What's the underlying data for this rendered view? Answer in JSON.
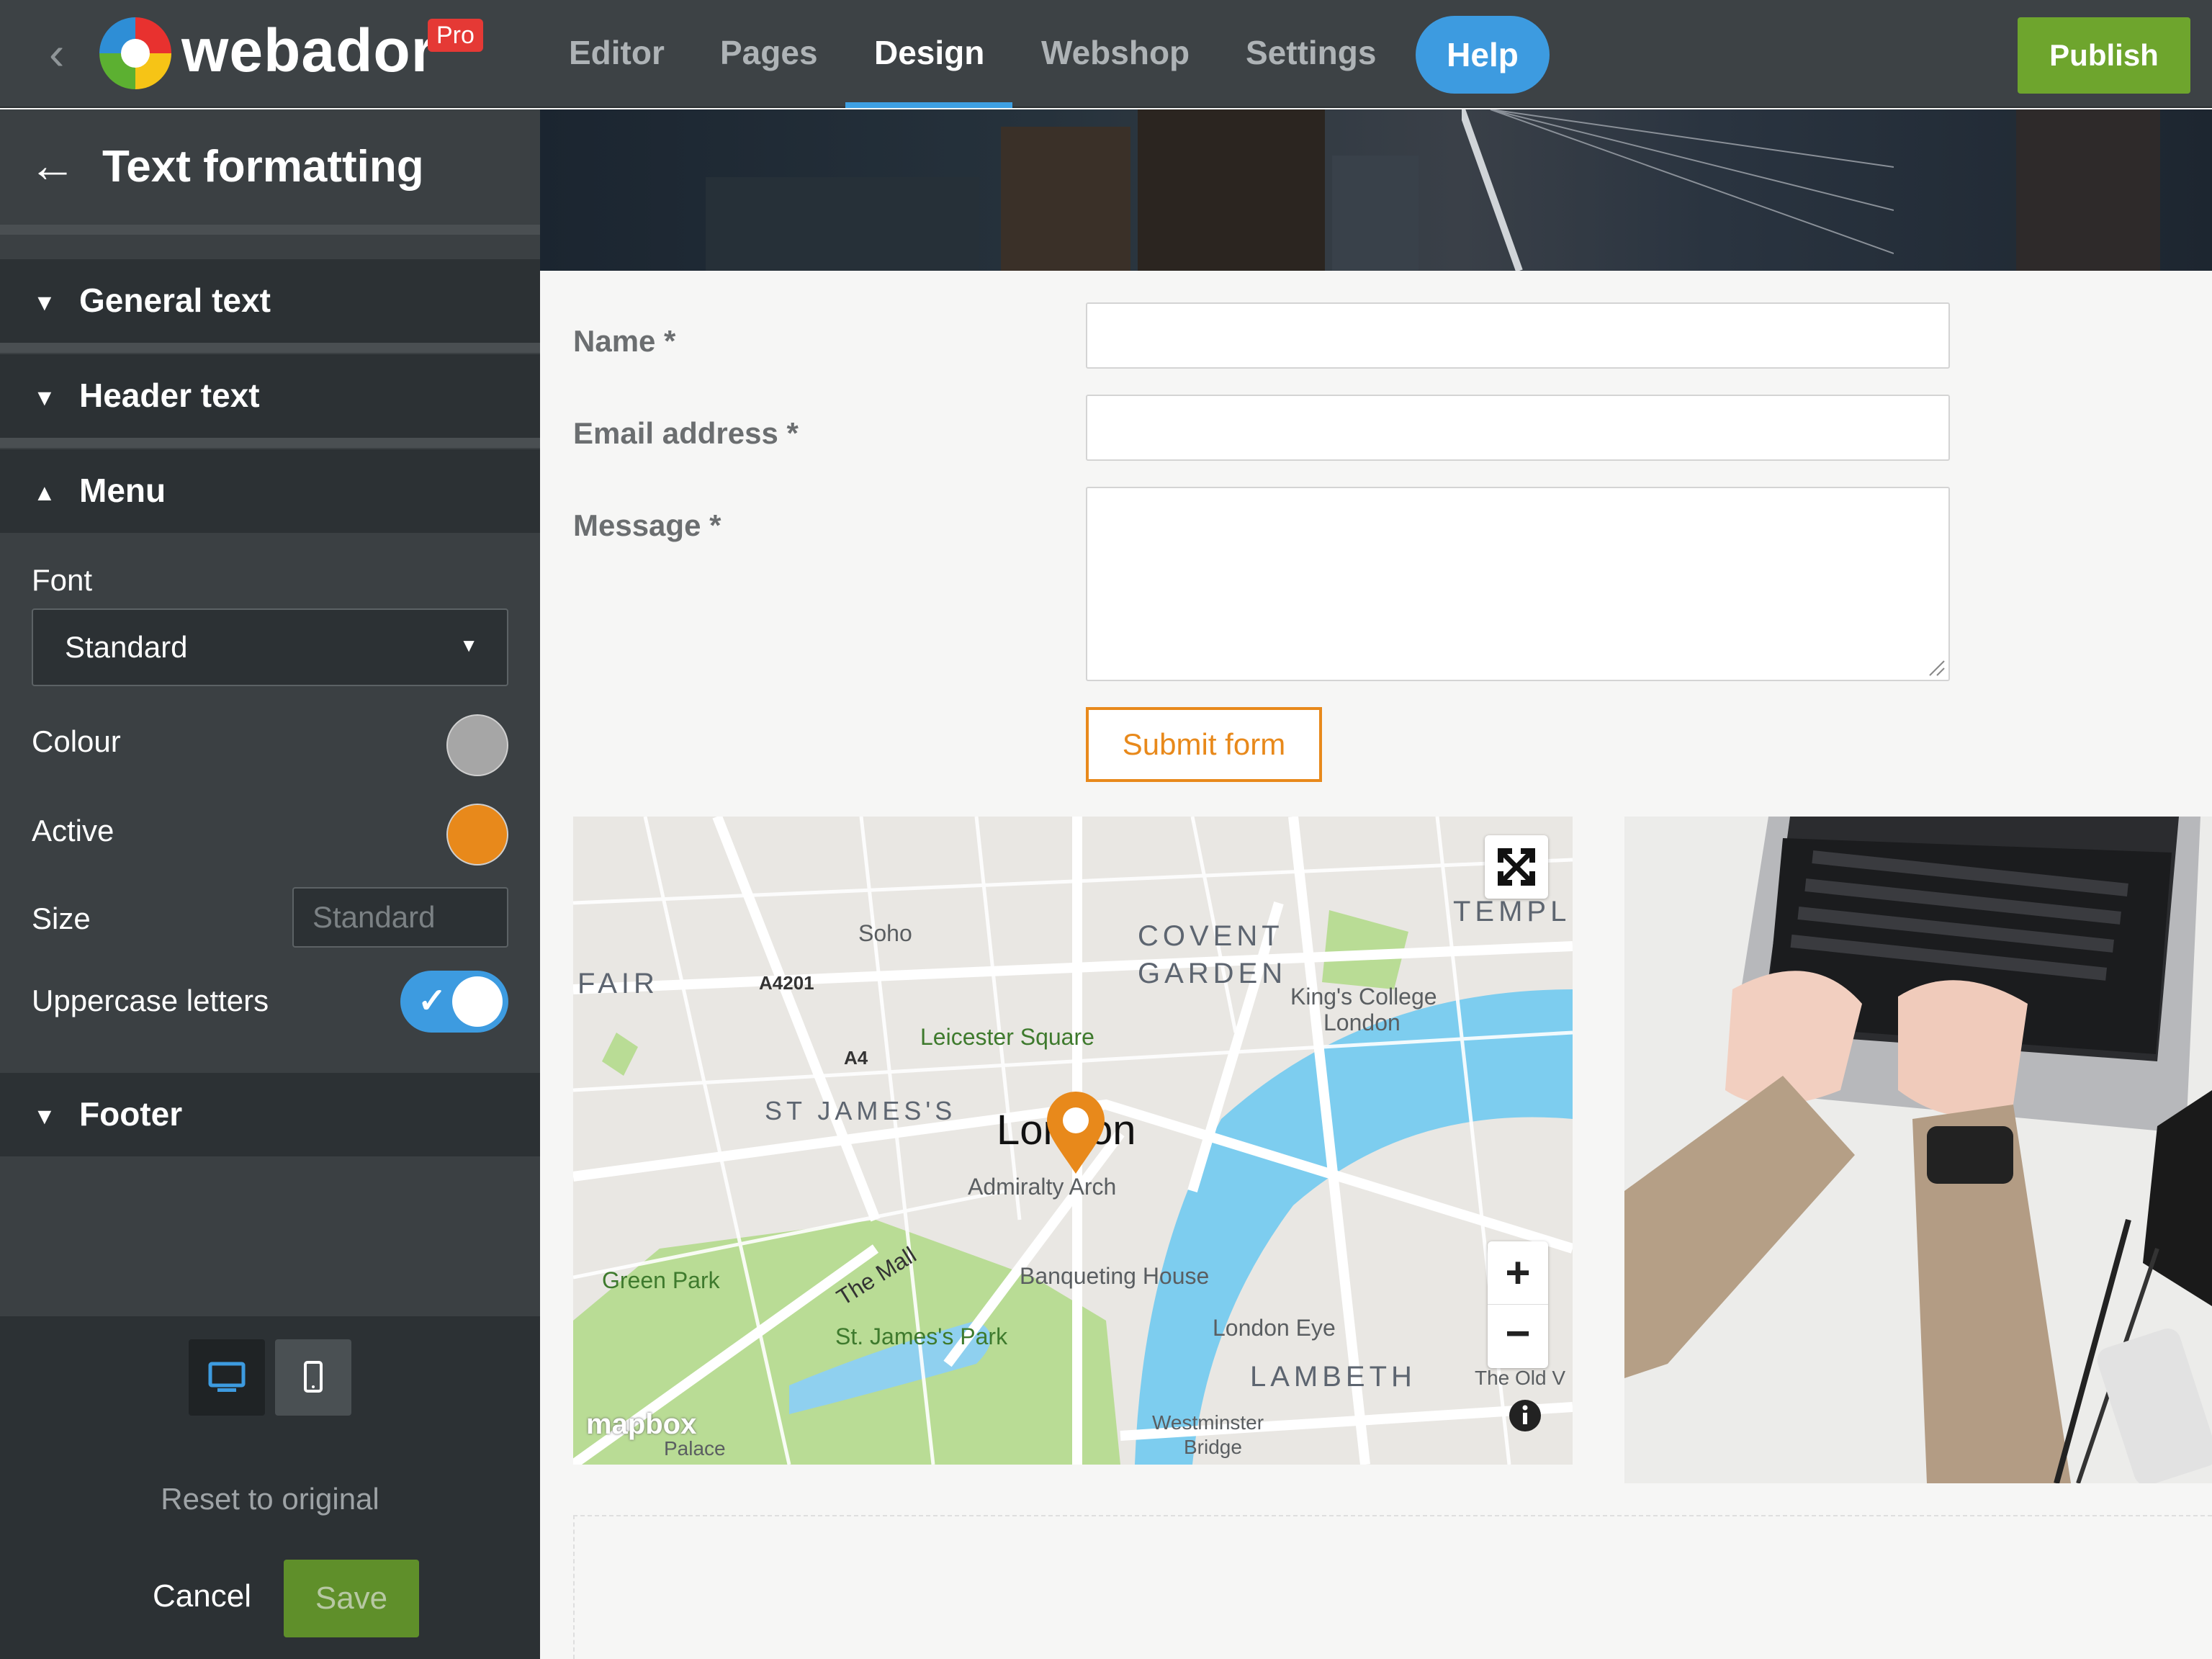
{
  "topbar": {
    "logo_text": "webador",
    "pro_badge": "Pro",
    "nav": [
      "Editor",
      "Pages",
      "Design",
      "Webshop",
      "Settings"
    ],
    "active_nav": "Design",
    "help_label": "Help",
    "publish_label": "Publish"
  },
  "sidebar": {
    "title": "Text formatting",
    "sections": {
      "general": "General text",
      "header": "Header text",
      "menu": "Menu",
      "footer": "Footer"
    },
    "menu": {
      "font_label": "Font",
      "font_value": "Standard",
      "colour_label": "Colour",
      "colour_value": "#a6a6a6",
      "active_label": "Active",
      "active_value": "#e8891b",
      "size_label": "Size",
      "size_placeholder": "Standard",
      "uppercase_label": "Uppercase letters",
      "uppercase_on": true
    },
    "reset_label": "Reset to original",
    "cancel_label": "Cancel",
    "save_label": "Save"
  },
  "form": {
    "name_label": "Name *",
    "email_label": "Email address *",
    "message_label": "Message *",
    "submit_label": "Submit form"
  },
  "map": {
    "labels": {
      "soho": "Soho",
      "covent": "COVENT",
      "garden": "GARDEN",
      "temple": "TEMPLE",
      "fair": "FAIR",
      "a4201": "A4201",
      "leicester": "Leicester Square",
      "kings1": "King's College",
      "kings2": "London",
      "a4": "A4",
      "stjames": "ST JAMES'S",
      "london": "London",
      "admiralty": "Admiralty Arch",
      "greenpark": "Green Park",
      "mall": "The Mall",
      "banqueting": "Banqueting House",
      "stjamespark": "St. James's Park",
      "londoneye": "London Eye",
      "lambeth": "LAMBETH",
      "oldv": "The Old V",
      "palace": "Palace",
      "westminster1": "Westminster",
      "westminster2": "Bridge",
      "mapbox": "mapbox"
    }
  }
}
